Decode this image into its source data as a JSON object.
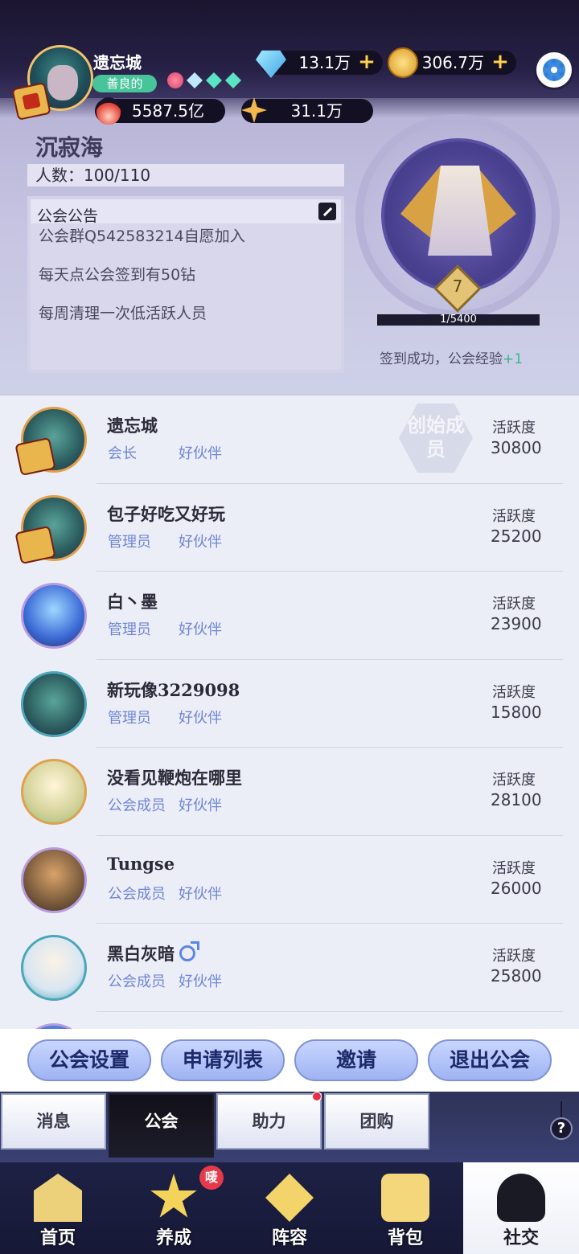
{
  "player": {
    "name": "遗忘城",
    "tag": "善良的",
    "diamonds": "13.1万",
    "coins": "306.7万",
    "power": "5587.5亿",
    "stars": "31.1万"
  },
  "guild": {
    "name": "沉寂海",
    "member_count": "人数：100/110",
    "notice_title": "公会公告",
    "notice_lines": [
      "公会群Q542583214自愿加入",
      "每天点公会签到有50钻",
      "每周清理一次低活跃人员"
    ],
    "level": "7",
    "exp_text": "1/5400",
    "exp_fraction": 0.0002,
    "signin_text": "签到成功，公会经验",
    "signin_bonus": "+1"
  },
  "members": [
    {
      "name": "遗忘城",
      "role": "会长",
      "friend": "好伙伴",
      "activity_label": "活跃度",
      "activity": "30800",
      "founder": "创始成员",
      "avatar": "green",
      "seal": true
    },
    {
      "name": "包子好吃又好玩",
      "role": "管理员",
      "friend": "好伙伴",
      "activity_label": "活跃度",
      "activity": "25200",
      "avatar": "green",
      "seal": true
    },
    {
      "name": "白丶墨",
      "role": "管理员",
      "friend": "好伙伴",
      "activity_label": "活跃度",
      "activity": "23900",
      "avatar": "blue"
    },
    {
      "name": "新玩像3229098",
      "role": "管理员",
      "friend": "好伙伴",
      "activity_label": "活跃度",
      "activity": "15800",
      "avatar": "green"
    },
    {
      "name": "没看见鞭炮在哪里",
      "role": "公会成员",
      "friend": "好伙伴",
      "activity_label": "活跃度",
      "activity": "28100",
      "avatar": "cream"
    },
    {
      "name": "Tungse",
      "role": "公会成员",
      "friend": "好伙伴",
      "activity_label": "活跃度",
      "activity": "26000",
      "avatar": "brown"
    },
    {
      "name": "黑白灰暗",
      "role": "公会成员",
      "friend": "好伙伴",
      "activity_label": "活跃度",
      "activity": "25800",
      "avatar": "white",
      "male": true
    }
  ],
  "actions": {
    "settings": "公会设置",
    "requests": "申请列表",
    "invite": "邀请",
    "leave": "退出公会"
  },
  "subtabs": [
    "消息",
    "公会",
    "助力",
    "团购"
  ],
  "nav": {
    "home": "首页",
    "develop": "养成",
    "develop_badge": "唛",
    "lineup": "阵容",
    "bag": "背包",
    "social": "社交"
  },
  "help_label": "?",
  "colors": {
    "accent": "#6f86d6",
    "bonus_green": "#35b98c",
    "nav_bg": "#1d2144"
  }
}
